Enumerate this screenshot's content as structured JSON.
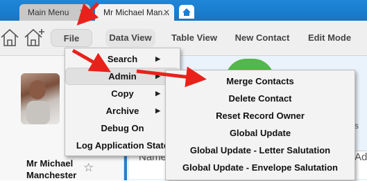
{
  "tabs": [
    {
      "label": "Main Menu",
      "close": "✕"
    },
    {
      "label": "Mr Michael Man...",
      "close": "✕"
    }
  ],
  "toolbar": {
    "file": "File",
    "data_view": "Data View",
    "table_view": "Table View",
    "new_contact": "New Contact",
    "edit_mode": "Edit Mode"
  },
  "contact": {
    "name_line1": "Mr Michael",
    "name_line2": "Manchester"
  },
  "file_menu": {
    "items": [
      {
        "label": "Search",
        "submenu": true
      },
      {
        "label": "Admin",
        "submenu": true,
        "highlighted": true
      },
      {
        "label": "Copy",
        "submenu": true
      },
      {
        "label": "Archive",
        "submenu": true
      },
      {
        "label": "Debug On",
        "submenu": false
      },
      {
        "label": "Log Application State",
        "submenu": false
      }
    ]
  },
  "admin_menu": {
    "items": [
      {
        "label": "Merge Contacts"
      },
      {
        "label": "Delete Contact"
      },
      {
        "label": "Reset Record Owner"
      },
      {
        "label": "Global Update"
      },
      {
        "label": "Global Update - Letter Salutation"
      },
      {
        "label": "Global Update - Envelope Salutation"
      }
    ]
  },
  "grid": {
    "col_name": "Name",
    "col_ad": "Ad",
    "side_text": "s"
  },
  "colors": {
    "tab_strip": "#1776c6",
    "annotation_arrow": "#e8221b",
    "green_accent": "#53b84b"
  }
}
